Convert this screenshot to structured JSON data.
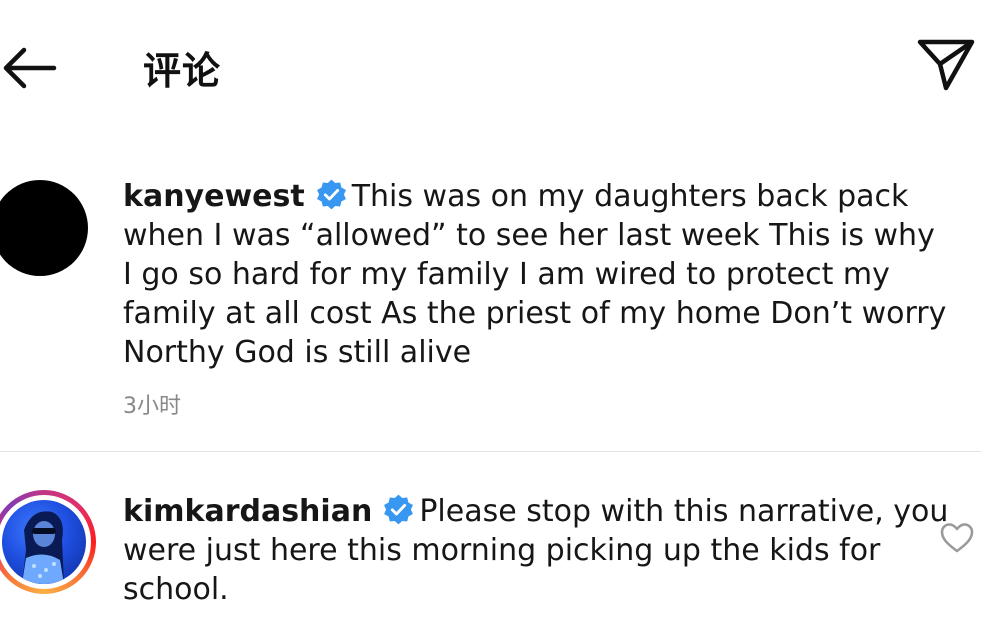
{
  "header": {
    "title": "评论",
    "back_icon": "arrow-left-icon",
    "send_icon": "paper-plane-icon"
  },
  "comments": [
    {
      "username": "kanyewest",
      "verified": true,
      "text": "This was on my daughters back pack when I was “allowed” to see her last week  This is why I go so hard for my family  I am wired to protect my family at all cost  As the priest of my home  Don’t worry Northy  God is still alive",
      "time": "3小时",
      "avatar_color": "#000000"
    },
    {
      "username": "kimkardashian",
      "verified": true,
      "text": "Please stop with this narrative, you were just here this morning picking up the kids for school.",
      "story_ring": true,
      "like_icon": "heart-outline-icon"
    }
  ],
  "colors": {
    "verified_badge": "#3897f0",
    "timestamp": "#888888",
    "divider": "#e4e4e4"
  }
}
